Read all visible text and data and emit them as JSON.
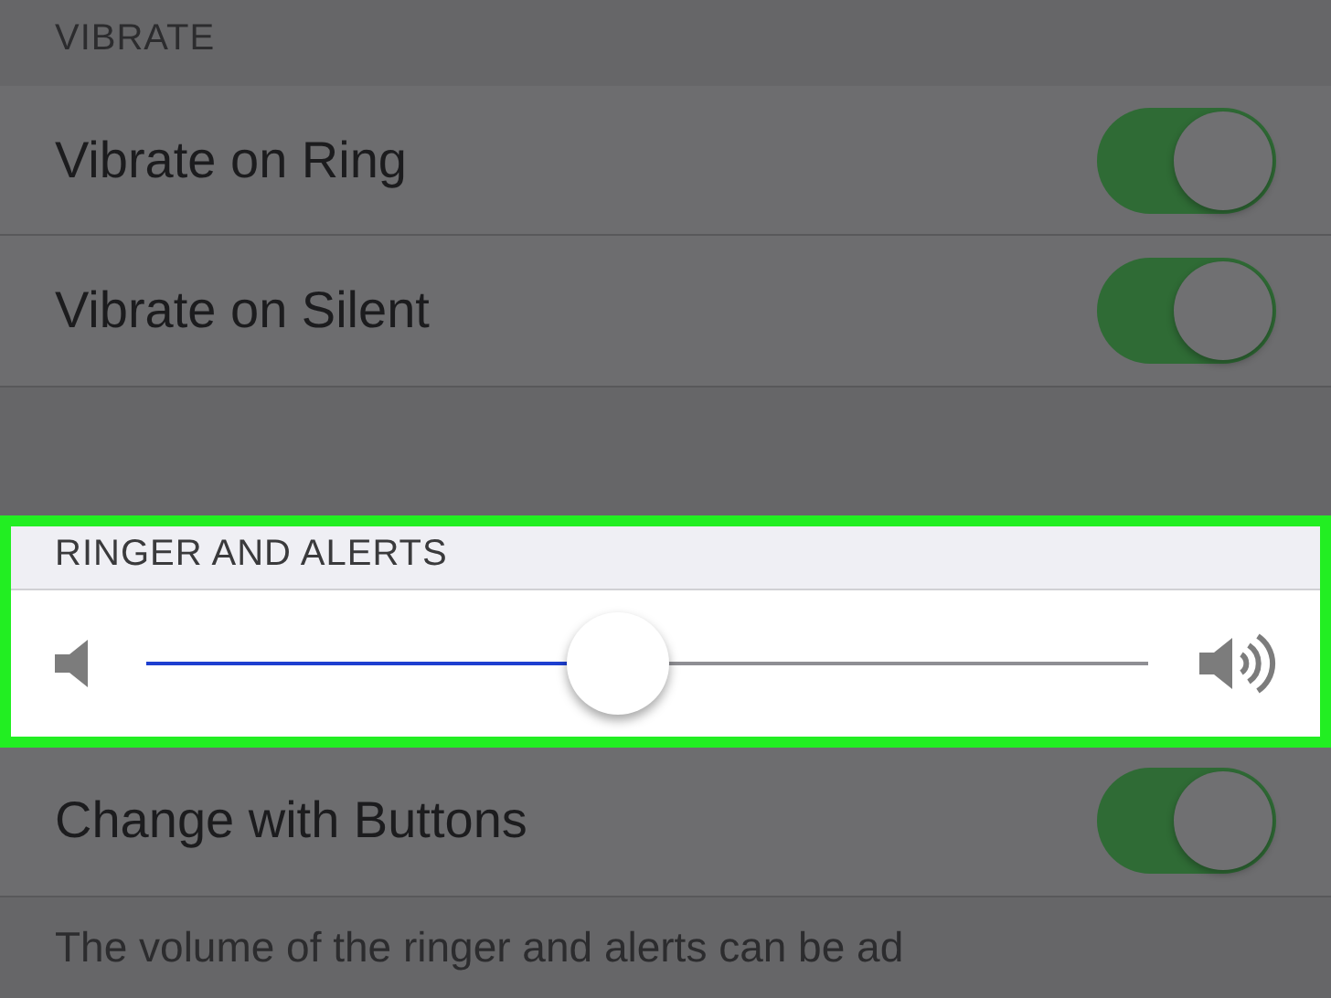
{
  "vibrate_section": {
    "header": "VIBRATE",
    "rows": [
      {
        "label": "Vibrate on Ring",
        "on": true
      },
      {
        "label": "Vibrate on Silent",
        "on": true
      }
    ]
  },
  "ringer_section": {
    "header": "RINGER AND ALERTS",
    "highlighted": true,
    "slider": {
      "level": 0.47
    }
  },
  "buttons_row": {
    "label": "Change with Buttons",
    "on": true
  },
  "footer": "The volume of the ringer and alerts can be ad"
}
